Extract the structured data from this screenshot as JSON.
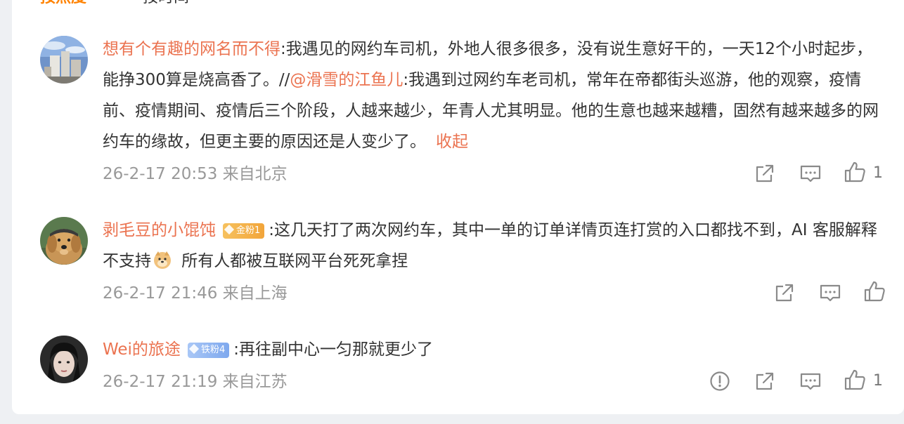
{
  "sort": {
    "hot_label": "按热度",
    "time_label": "按时间"
  },
  "comments": [
    {
      "user": "想有个有趣的网名而不得",
      "sep": ":",
      "text_before_mention": "我遇见的网约车司机，外地人很多很多，没有说生意好干的，一天12个小时起步，能挣300算是烧高香了。//",
      "mention": "@滑雪的江鱼儿",
      "text_after_mention": ":我遇到过网约车老司机，常年在帝都街头巡游，他的观察，疫情前、疫情期间、疫情后三个阶段，人越来越少，年青人尤其明显。他的生意也越来越糟，固然有越来越多的网约车的缘故，但更主要的原因还是人变少了。",
      "collapse_label": "收起",
      "meta": "26-2-17 20:53 来自北京",
      "like_count": "1"
    },
    {
      "user": "剥毛豆的小馄饨",
      "badge": "金粉1",
      "sep": ":",
      "text_part1": "这几天打了两次网约车，其中一单的订单详情页连打赏的入口都找不到，AI 客服解释不支持",
      "text_part2": " 所有人都被互联网平台死死拿捏",
      "meta": "26-2-17 21:46 来自上海"
    },
    {
      "user": "Wei的旅途",
      "badge": "铁粉4",
      "sep": ":",
      "text": "再往副中心一匀那就更少了",
      "meta": "26-2-17 21:19 来自江苏",
      "like_count": "1"
    }
  ],
  "colors": {
    "username": "#eb7350",
    "meta": "#999999",
    "text": "#333333",
    "tab_active": "#ff8200"
  },
  "icons": [
    "share-icon",
    "comment-icon",
    "like-icon",
    "report-icon",
    "doge-emoji-icon"
  ]
}
